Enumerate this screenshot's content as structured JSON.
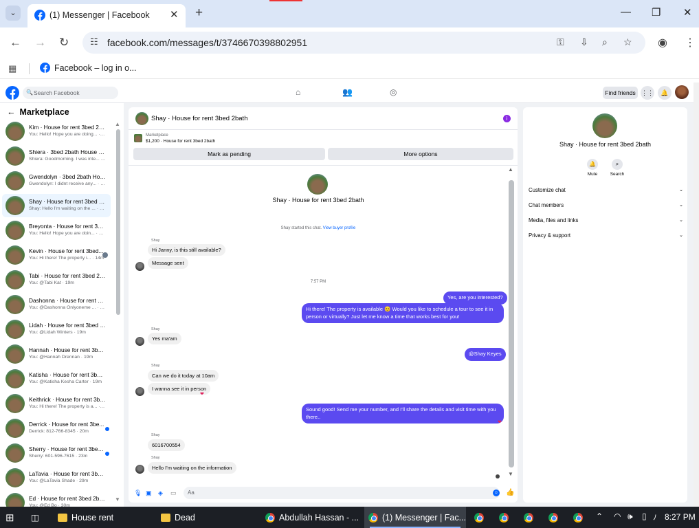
{
  "browser": {
    "tab_title": "(1) Messenger | Facebook",
    "url": "facebook.com/messages/t/3746670398802951",
    "bookmark": "Facebook – log in o..."
  },
  "fb": {
    "search_placeholder": "Search Facebook",
    "find_friends": "Find friends"
  },
  "sidebar": {
    "title": "Marketplace",
    "conversations": [
      {
        "name": "Kim · House for rent 3bed 2ba...",
        "preview": "You: Hello! Hope you are doing... · 1m",
        "active": false,
        "unread": false
      },
      {
        "name": "Shiera · 3bed 2bath House for...",
        "preview": "Shiera: Goodmorning. I was inte... · 8m",
        "active": false,
        "unread": false
      },
      {
        "name": "Gwendolyn · 3bed 2bath Hous...",
        "preview": "Gwendolyn: I didnt receive any... · 10m",
        "active": false,
        "unread": false
      },
      {
        "name": "Shay · House for rent 3bed 2b...",
        "preview": "Shay: Hello I'm waiting on the ... · 12m",
        "active": true,
        "unread": false
      },
      {
        "name": "Breyonta · House for rent 3be...",
        "preview": "You: Hello! Hope you are doin... · 14m",
        "active": false,
        "unread": false
      },
      {
        "name": "Kevin · House for rent 3bed...",
        "preview": "You: Hi there! The property i... · 14m",
        "active": false,
        "unread": false,
        "seen": true
      },
      {
        "name": "Tabi · House for rent 3bed 2ba...",
        "preview": "You: @Tabi Kat · 19m",
        "active": false,
        "unread": false
      },
      {
        "name": "Dashonna · House for rent 3b...",
        "preview": "You: @Dashonna Onlyoneme ... · 19m",
        "active": false,
        "unread": false
      },
      {
        "name": "Lidah · House for rent 3bed 2...",
        "preview": "You: @Lidah Winters · 19m",
        "active": false,
        "unread": false
      },
      {
        "name": "Hannah · House for rent 3bed...",
        "preview": "You: @Hannah Drennan · 19m",
        "active": false,
        "unread": false
      },
      {
        "name": "Katisha · House for rent 3bed ...",
        "preview": "You: @Katisha Kesha Carter · 19m",
        "active": false,
        "unread": false
      },
      {
        "name": "Keithrick · House for rent 3be...",
        "preview": "You: Hi there! The property is a... · 20m",
        "active": false,
        "unread": false
      },
      {
        "name": "Derrick · House for rent 3be...",
        "preview": "Derrick: 812-766-8345 · 20m",
        "active": false,
        "unread": true
      },
      {
        "name": "Sherry · House for rent 3bed...",
        "preview": "Sherry: 601-596-7615 · 23m",
        "active": false,
        "unread": true
      },
      {
        "name": "LaTavia · House for rent 3bed ...",
        "preview": "You: @LaTavia Shade · 29m",
        "active": false,
        "unread": false
      },
      {
        "name": "Ed · House for rent 3bed 2bath",
        "preview": "You: @Ed Bo · 30m",
        "active": false,
        "unread": false
      }
    ]
  },
  "chat": {
    "title": "Shay · House for rent 3bed 2bath",
    "marketplace_label": "Marketplace",
    "listing": "$1,200 · House for rent 3bed 2bath",
    "mark_pending": "Mark as pending",
    "more_options": "More options",
    "header_title": "Shay · House for rent 3bed 2bath",
    "started": "Shay started this chat.",
    "view_profile": "View buyer profile",
    "sender": "Shay",
    "in1": "Hi Janny, is this still available?",
    "in2": "Message sent",
    "time1": "7:57 PM",
    "out1": "Yes, are you interested?",
    "out2": "Hi there! The property is available 😊 Would you like to schedule a tour to see it in person or virtually? Just let me know a time that works best for you!",
    "in3": "Yes ma'am",
    "out3": "@Shay Keyes",
    "in4": "Can we do it today at 10am",
    "in5": "I wanna see it in person",
    "out4": "Sound good! Send me your number, and I'll share the details and visit time with you there..",
    "in6": "6016700554",
    "in7": "Hello I'm waiting on the information",
    "composer_placeholder": "Aa"
  },
  "details": {
    "title": "Shay · House for rent 3bed 2bath",
    "mute": "Mute",
    "search": "Search",
    "sections": [
      "Customize chat",
      "Chat members",
      "Media, files and links",
      "Privacy & support"
    ]
  },
  "taskbar": {
    "items": [
      "House rent",
      "Dead",
      "Abdullah Hassan - ...",
      "(1) Messenger | Fac..."
    ],
    "time": "8:27 PM"
  }
}
